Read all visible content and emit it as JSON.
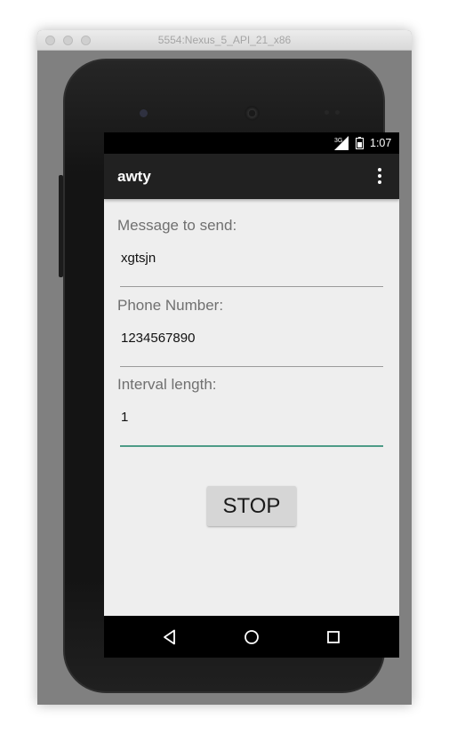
{
  "window": {
    "title": "5554:Nexus_5_API_21_x86"
  },
  "status_bar": {
    "network": "3G",
    "time": "1:07",
    "icons": [
      "cell-signal-icon",
      "battery-icon"
    ]
  },
  "app_bar": {
    "title": "awty",
    "menu_icon": "overflow-menu-icon"
  },
  "form": {
    "message": {
      "label": "Message to send:",
      "value": "xgtsjn"
    },
    "phone": {
      "label": "Phone Number:",
      "value": "1234567890"
    },
    "interval": {
      "label": "Interval length:",
      "value": "1"
    },
    "stop_button": "STOP"
  },
  "nav_bar": {
    "icons": [
      "back-icon",
      "home-icon",
      "recents-icon"
    ]
  },
  "colors": {
    "app_bar": "#212121",
    "screen_bg": "#eeeeee",
    "focus_accent": "#4d9b87",
    "button_bg": "#d6d6d6"
  }
}
